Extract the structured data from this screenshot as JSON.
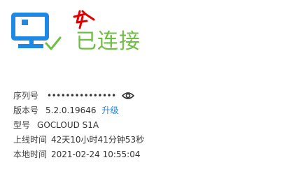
{
  "status": {
    "text": "已连接",
    "color": "#6fbe44",
    "icon": "router-connected-icon",
    "icon_color": "#1e88e5",
    "check_color": "#6fbe44"
  },
  "info": {
    "serial": {
      "label": "序列号",
      "value": "•••••••••••••••",
      "toggle_icon": "eye-icon"
    },
    "version": {
      "label": "版本号",
      "value": "5.2.0.19646",
      "upgrade_label": "升级"
    },
    "model": {
      "label": "型号",
      "value": "GOCLOUD S1A"
    },
    "uptime": {
      "label": "上线时间",
      "value": "42天10小时41分钟53秒"
    },
    "local_time": {
      "label": "本地时间",
      "value": "2021-02-24 10:55:04"
    }
  },
  "colors": {
    "link": "#1e88e5",
    "annotation": "#e00000"
  }
}
